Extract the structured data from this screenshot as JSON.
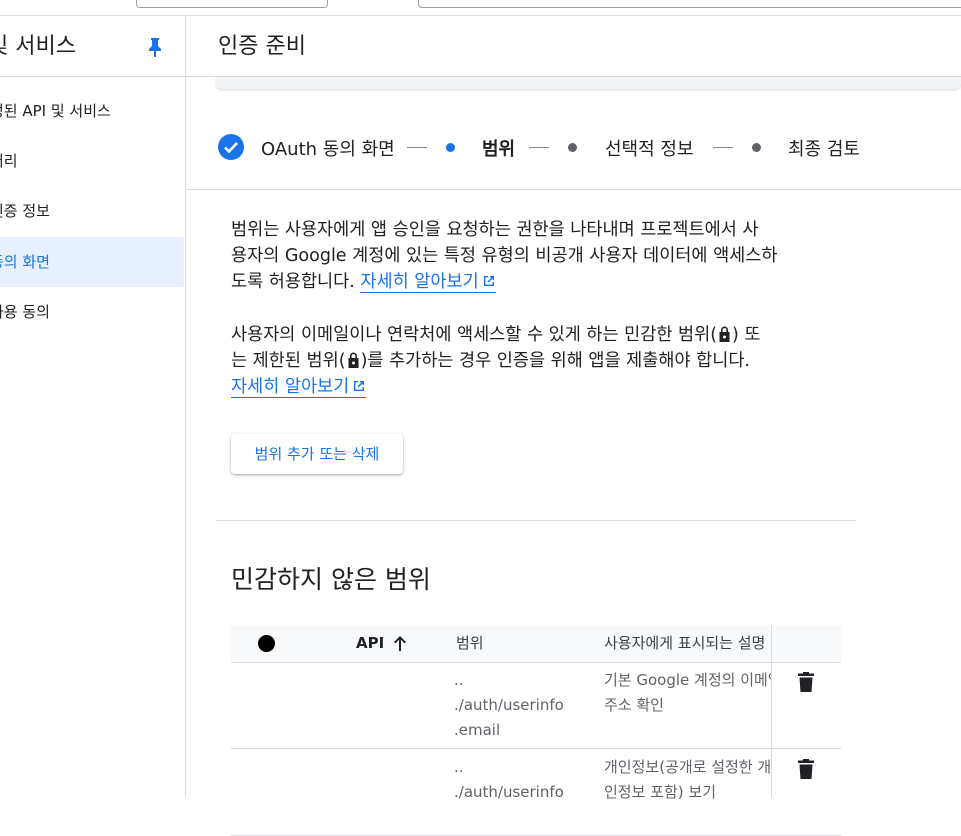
{
  "sidebar": {
    "title": "및 서비스",
    "items": [
      {
        "label": "정된 API 및 서비스"
      },
      {
        "label": "러리"
      },
      {
        "label": "인증 정보"
      },
      {
        "label": "동의 화면"
      },
      {
        "label": "사용 동의"
      }
    ]
  },
  "header": {
    "title": "인증 준비"
  },
  "stepper": {
    "steps": [
      {
        "label": "OAuth 동의 화면",
        "state": "done"
      },
      {
        "label": "범위",
        "state": "active"
      },
      {
        "label": "선택적 정보",
        "state": "pending"
      },
      {
        "label": "최종 검토",
        "state": "pending"
      }
    ]
  },
  "intro": {
    "line1": "범위는 사용자에게 앱 승인을 요청하는 권한을 나타내며 프로젝트에서 사",
    "line2": "용자의 Google 계정에 있는 특정 유형의 비공개 사용자 데이터에 액세스하",
    "line3": "도록 허용합니다.",
    "link": "자세히 알아보기"
  },
  "sensitive": {
    "line1a": "사용자의 이메일이나 연락처에 액세스할 수 있게 하는 민감한 범위(",
    "line1b": ") 또",
    "line2a": "는 제한된 범위(",
    "line2b": ")를 추가하는 경우 인증을 위해 앱을 제출해야 합니다.",
    "link": "자세히 알아보기"
  },
  "actions": {
    "add_remove_scopes": "범위 추가 또는 삭제"
  },
  "section": {
    "title": "민감하지 않은 범위"
  },
  "table": {
    "columns": {
      "api": "API",
      "scope": "범위",
      "description": "사용자에게 표시되는 설명"
    },
    "rows": [
      {
        "scope_l1": "..",
        "scope_l2": "./auth/userinfo",
        "scope_l3": ".email",
        "desc_l1": "기본 Google 계정의 이메일",
        "desc_l2": "주소 확인"
      },
      {
        "scope_l1": "..",
        "scope_l2": "./auth/userinfo",
        "scope_l3": "",
        "desc_l1": "개인정보(공개로 설정한 개",
        "desc_l2": "인정보 포함) 보기"
      }
    ]
  },
  "colors": {
    "accent": "#1a73e8",
    "active_bg": "#e8f0fe"
  }
}
